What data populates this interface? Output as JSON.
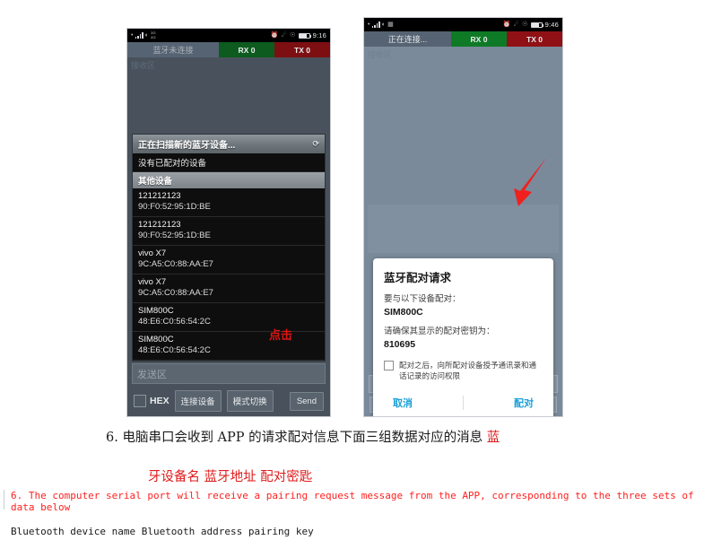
{
  "phone_left": {
    "statusbar": {
      "time": "9:16",
      "net_top": "3G",
      "net_bottom": "4G"
    },
    "title": "蓝牙未连接",
    "rx_label": "RX 0",
    "tx_label": "TX 0",
    "receive_area_label": "接收区",
    "scan_row": "正在扫描新的蓝牙设备...",
    "no_paired": "没有已配对的设备",
    "other_devices_header": "其他设备",
    "devices": [
      {
        "name": "121212123",
        "address": "90:F0:52:95:1D:BE"
      },
      {
        "name": "121212123",
        "address": "90:F0:52:95:1D:BE"
      },
      {
        "name": "vivo X7",
        "address": "9C:A5:C0:88:AA:E7"
      },
      {
        "name": "vivo X7",
        "address": "9C:A5:C0:88:AA:E7"
      },
      {
        "name": "SIM800C",
        "address": "48:E6:C0:56:54:2C"
      },
      {
        "name": "SIM800C",
        "address": "48:E6:C0:56:54:2C"
      }
    ],
    "send_area_placeholder": "发送区",
    "hex_label": "HEX",
    "connect_button": "连接设备",
    "mode_button": "模式切换",
    "send_button": "Send",
    "annotation": "点击"
  },
  "phone_right": {
    "statusbar": {
      "time": "9:46"
    },
    "title": "正在连接...",
    "rx_label": "RX 0",
    "tx_label": "TX 0",
    "receive_area_label": "接收区",
    "dialog": {
      "title": "蓝牙配对请求",
      "pair_with_label": "要与以下设备配对：",
      "device_name": "SIM800C",
      "key_label": "请确保其显示的配对密钥为：",
      "pairing_key": "810695",
      "permission_text": "配对之后，向所配对设备授予通讯录和通话记录的访问权限",
      "cancel_button": "取消",
      "pair_button": "配对"
    }
  },
  "caption": {
    "cn_line1_black": "6. 电脑串口会收到 APP 的请求配对信息下面三组数据对应的消息",
    "cn_line1_red": "蓝",
    "cn_line2_red": "牙设备名 蓝牙地址 配对密匙",
    "en_red": "6. The computer serial port will receive a pairing request message from the APP, corresponding to the three sets of data below",
    "en_black": "Bluetooth device name Bluetooth address pairing key"
  },
  "colors": {
    "rx_green": "#0d5b1f",
    "tx_red": "#7d0f12",
    "dialog_accent": "#1b9fd8",
    "annotation_red": "#e31212",
    "caption_red": "#ff2020"
  }
}
